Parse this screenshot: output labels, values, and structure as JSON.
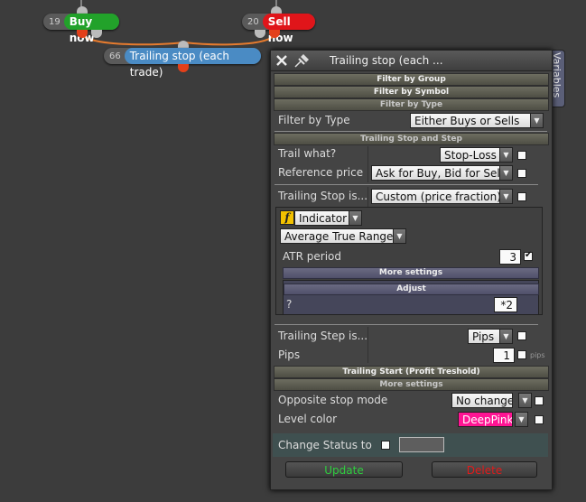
{
  "nodes": {
    "buy": {
      "num": "19",
      "label": "Buy now"
    },
    "sell": {
      "num": "20",
      "label": "Sell now"
    },
    "trailing": {
      "num": "66",
      "label": "Trailing stop (each trade)"
    }
  },
  "dialog": {
    "title": "Trailing stop (each ...",
    "variables_tab": "Variables",
    "bands": {
      "filter_group": "Filter by Group",
      "filter_symbol": "Filter by Symbol",
      "filter_type": "Filter by Type",
      "trailing_stop_step": "Trailing Stop and Step",
      "trailing_start": "Trailing Start (Profit Treshold)",
      "more_settings": "More settings"
    },
    "filter_type": {
      "label": "Filter by Type",
      "value": "Either Buys or Sells"
    },
    "trail_what": {
      "label": "Trail what?",
      "value": "Stop-Loss"
    },
    "reference_price": {
      "label": "Reference price",
      "value": "Ask for Buy, Bid for Sell"
    },
    "trailing_stop_is": {
      "label": "Trailing Stop is...",
      "value": "Custom (price fraction)"
    },
    "indicator": {
      "icon": "f",
      "value": "Indicator"
    },
    "indicator_type": {
      "value": "Average True Range"
    },
    "atr_period": {
      "label": "ATR period",
      "value": "3"
    },
    "inner_more_settings": "More settings",
    "adjust": {
      "label": "Adjust",
      "left": "?",
      "value": "*2"
    },
    "trailing_step_is": {
      "label": "Trailing Step is...",
      "value": "Pips"
    },
    "pips": {
      "label": "Pips",
      "value": "1",
      "unit": "pips"
    },
    "opposite_stop_mode": {
      "label": "Opposite stop mode",
      "value": "No change"
    },
    "level_color": {
      "label": "Level color",
      "value": "DeepPink"
    },
    "change_status": {
      "label": "Change Status to"
    },
    "buttons": {
      "update": "Update",
      "delete": "Delete"
    }
  },
  "colors": {
    "buy": "#22a22a",
    "sell": "#e0151a",
    "trailing": "#4a8bc4",
    "update_text": "#2fcf3f",
    "delete_text": "#e21a1a",
    "deeppink": "#ff1493",
    "connector_line": "#e67b2e"
  }
}
